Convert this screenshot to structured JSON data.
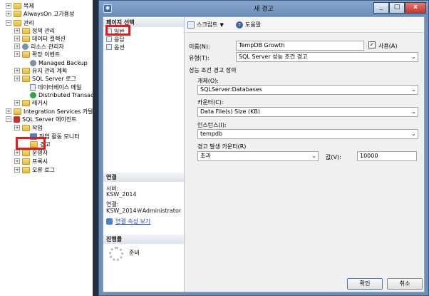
{
  "tree": {
    "items": [
      {
        "label": "복제",
        "exp": "+",
        "icon": "folder"
      },
      {
        "label": "AlwaysOn 고가용성",
        "exp": "+",
        "icon": "folder"
      },
      {
        "label": "관리",
        "exp": "−",
        "icon": "folder"
      },
      {
        "label": "정책 관리",
        "exp": "+",
        "icon": "folder"
      },
      {
        "label": "데이터 컬렉션",
        "exp": "+",
        "icon": "folder"
      },
      {
        "label": "리소스 관리자",
        "exp": "+",
        "icon": "gear"
      },
      {
        "label": "확장 이벤트",
        "exp": "+",
        "icon": "folder"
      },
      {
        "label": "Managed Backup",
        "exp": "",
        "icon": "gear"
      },
      {
        "label": "유지 관리 계획",
        "exp": "+",
        "icon": "folder"
      },
      {
        "label": "SQL Server 로그",
        "exp": "+",
        "icon": "folder"
      },
      {
        "label": "데이터베이스 메일",
        "exp": "",
        "icon": "doc"
      },
      {
        "label": "Distributed Transaction C",
        "exp": "",
        "icon": "green"
      },
      {
        "label": "레거시",
        "exp": "+",
        "icon": "folder"
      },
      {
        "label": "Integration Services 카탈로그",
        "exp": "+",
        "icon": "folder"
      },
      {
        "label": "SQL Server 에이전트",
        "exp": "−",
        "icon": "agent"
      },
      {
        "label": "작업",
        "exp": "+",
        "icon": "folder"
      },
      {
        "label": "작업 활동 모니터",
        "exp": "",
        "icon": "mon"
      },
      {
        "label": "경고",
        "exp": "",
        "icon": "folder"
      },
      {
        "label": "운영자",
        "exp": "+",
        "icon": "folder"
      },
      {
        "label": "프록시",
        "exp": "+",
        "icon": "folder"
      },
      {
        "label": "오류 로그",
        "exp": "+",
        "icon": "folder"
      }
    ]
  },
  "dialog": {
    "title": "새 경고",
    "app_icon": "app-icon",
    "buttons": {
      "minimize": "_",
      "maximize": "□",
      "close": "x"
    },
    "left": {
      "pages_header": "페이지 선택",
      "pages": [
        "일반",
        "응답",
        "옵션"
      ],
      "connection_header": "연결",
      "server_label": "서버:",
      "server_value": "KSW_2014",
      "conn_label": "연결:",
      "conn_value": "KSW_2014￦Administrator",
      "conn_link": "연결 속성 보기",
      "progress_header": "진행률",
      "progress_status": "준비"
    },
    "toolbar": {
      "script": "스크립트",
      "script_dd": "▼",
      "help": "도움말"
    },
    "form": {
      "name_label": "이름(N):",
      "name_value": "TempDB Growth",
      "enable_label": "사용(A)",
      "enable_checked": "✓",
      "type_label": "유형(T):",
      "type_value": "SQL Server 성능 조건 경고",
      "group_label": "성능 조건 경고 정의",
      "object_label": "개체(O):",
      "object_value": "SQLServer:Databases",
      "counter_label": "카운터(C):",
      "counter_value": "Data File(s) Size (KB)",
      "instance_label": "인스턴스(I):",
      "instance_value": "tempdb",
      "alert_if_label": "경고 발생 카운터(R)",
      "alert_if_value": "초과",
      "value_label": "값(V):",
      "value_value": "10000"
    },
    "ok": "확인",
    "cancel": "취소"
  }
}
